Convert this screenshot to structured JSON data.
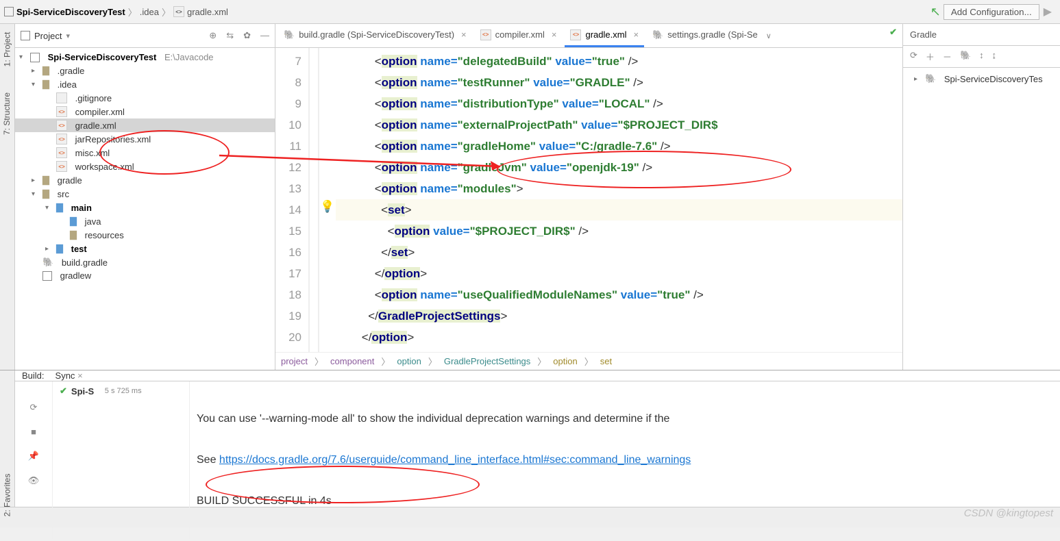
{
  "topbar": {
    "project": "Spi-ServiceDiscoveryTest",
    "crumb2": ".idea",
    "crumb3": "gradle.xml",
    "add_config": "Add Configuration..."
  },
  "leftStrip": {
    "project": "1: Project",
    "structure": "7: Structure"
  },
  "projectPanel": {
    "title": "Project",
    "root": "Spi-ServiceDiscoveryTest",
    "rootPath": "E:\\Javacode",
    "items": {
      "gradle_dir": ".gradle",
      "idea_dir": ".idea",
      "gitignore": ".gitignore",
      "compiler": "compiler.xml",
      "gradlexml": "gradle.xml",
      "jarRepos": "jarRepositories.xml",
      "misc": "misc.xml",
      "workspace": "workspace.xml",
      "gradle2": "gradle",
      "src": "src",
      "main": "main",
      "java": "java",
      "resources": "resources",
      "test": "test",
      "buildg": "build.gradle",
      "gradlew": "gradlew"
    }
  },
  "tabs": {
    "t0": "build.gradle (Spi-ServiceDiscoveryTest)",
    "t1": "compiler.xml",
    "t2": "gradle.xml",
    "t3": "settings.gradle (Spi-Se"
  },
  "codeLines": [
    7,
    8,
    9,
    10,
    11,
    12,
    13,
    14,
    15,
    16,
    17,
    18,
    19,
    20
  ],
  "code": {
    "l7": {
      "ind": "            ",
      "open": "<option ",
      "a1": "name=",
      "v1": "\"delegatedBuild\"",
      "a2": " value=",
      "v2": "\"true\"",
      "close": " />"
    },
    "l8": {
      "ind": "            ",
      "open": "<option ",
      "a1": "name=",
      "v1": "\"testRunner\"",
      "a2": " value=",
      "v2": "\"GRADLE\"",
      "close": " />"
    },
    "l9": {
      "ind": "            ",
      "open": "<option ",
      "a1": "name=",
      "v1": "\"distributionType\"",
      "a2": " value=",
      "v2": "\"LOCAL\"",
      "close": " />"
    },
    "l10": {
      "ind": "            ",
      "open": "<option ",
      "a1": "name=",
      "v1": "\"externalProjectPath\"",
      "a2": " value=",
      "v2": "\"$PROJECT_DIR$",
      "close": ""
    },
    "l11": {
      "ind": "            ",
      "open": "<option ",
      "a1": "name=",
      "v1": "\"gradleHome\"",
      "a2": " value=",
      "v2": "\"C:/gradle-7.6\"",
      "close": " />"
    },
    "l12": {
      "ind": "            ",
      "open": "<option ",
      "a1": "name=",
      "v1": "\"gradleJvm\"",
      "a2": " value=",
      "v2": "\"openjdk-19\"",
      "close": " />"
    },
    "l13": {
      "ind": "            ",
      "open": "<option ",
      "a1": "name=",
      "v1": "\"modules\"",
      "close": ">"
    },
    "l14": {
      "ind": "              ",
      "open": "<set>",
      "close": ""
    },
    "l15": {
      "ind": "                ",
      "open": "<option ",
      "a1": "value=",
      "v1": "\"$PROJECT_DIR$\"",
      "close": " />"
    },
    "l16": {
      "ind": "              ",
      "open": "</set>",
      "close": ""
    },
    "l17": {
      "ind": "            ",
      "open": "</option>",
      "close": ""
    },
    "l18": {
      "ind": "            ",
      "open": "<option ",
      "a1": "name=",
      "v1": "\"useQualifiedModuleNames\"",
      "a2": " value=",
      "v2": "\"true\"",
      "close": " />"
    },
    "l19": {
      "ind": "          ",
      "open": "</GradleProjectSettings>",
      "close": ""
    },
    "l20": {
      "ind": "        ",
      "open": "</option>",
      "close": ""
    }
  },
  "pathbar": {
    "p1": "project",
    "p2": "component",
    "p3": "option",
    "p4": "GradleProjectSettings",
    "p5": "option",
    "p6": "set"
  },
  "gradle": {
    "title": "Gradle",
    "root": "Spi-ServiceDiscoveryTes"
  },
  "build": {
    "label": "Build:",
    "sync": "Sync",
    "task": "Spi-S",
    "time": "5 s 725 ms",
    "line1": "You can use '--warning-mode all' to show the individual deprecation warnings and determine if the",
    "line2_pre": "See ",
    "line2_link": "https://docs.gradle.org/7.6/userguide/command_line_interface.html#sec:command_line_warnings",
    "line3": "BUILD SUCCESSFUL in 4s"
  },
  "favoritesStrip": "2: Favorites",
  "watermark": "CSDN @kingtopest"
}
